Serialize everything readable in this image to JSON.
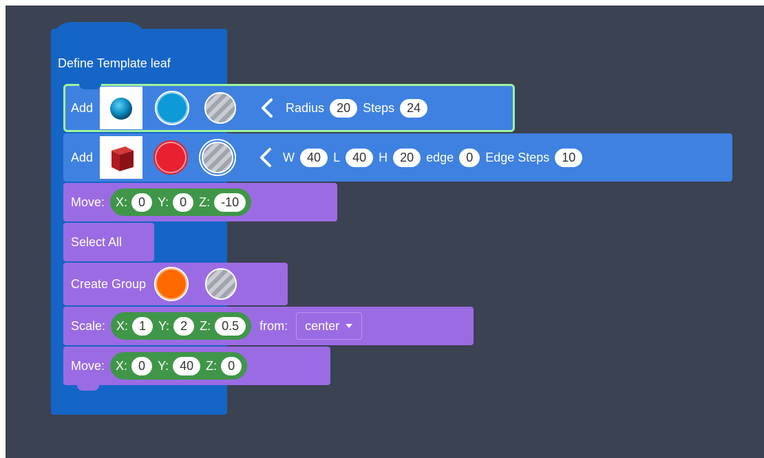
{
  "define_block": {
    "label": "Define Template leaf",
    "color": "#1565c7"
  },
  "add_sphere": {
    "label": "Add",
    "shape_icon": "sphere-thumbnail",
    "color_swatch": "#0d9ad8",
    "texture_icon": "hatched-circle-icon",
    "radius_label": "Radius",
    "radius_value": "20",
    "steps_label": "Steps",
    "steps_value": "24"
  },
  "add_box": {
    "label": "Add",
    "shape_icon": "cube-thumbnail",
    "color_swatch": "#e8202f",
    "texture_icon": "hatched-circle-icon",
    "w_label": "W",
    "w_value": "40",
    "l_label": "L",
    "l_value": "40",
    "h_label": "H",
    "h_value": "20",
    "edge_label": "edge",
    "edge_value": "0",
    "edge_steps_label": "Edge Steps",
    "edge_steps_value": "10"
  },
  "move1": {
    "label": "Move:",
    "x_label": "X:",
    "x": "0",
    "y_label": "Y:",
    "y": "0",
    "z_label": "Z:",
    "z": "-10"
  },
  "select_all": {
    "label": "Select All"
  },
  "create_group": {
    "label": "Create Group",
    "color_swatch": "#ff6a00",
    "texture_icon": "hatched-circle-icon"
  },
  "scale": {
    "label": "Scale:",
    "x_label": "X:",
    "x": "1",
    "y_label": "Y:",
    "y": "2",
    "z_label": "Z:",
    "z": "0.5",
    "from_label": "from:",
    "from_value": "center",
    "dropdown_icon": "chevron-down-icon"
  },
  "move2": {
    "label": "Move:",
    "x_label": "X:",
    "x": "0",
    "y_label": "Y:",
    "y": "40",
    "z_label": "Z:",
    "z": "0"
  }
}
